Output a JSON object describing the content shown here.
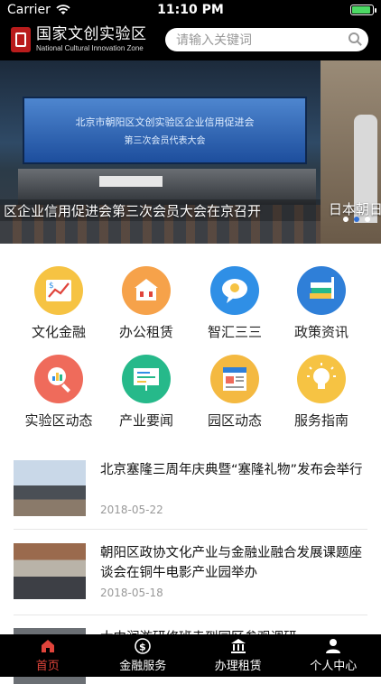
{
  "status_bar": {
    "carrier": "Carrier",
    "time": "11:10 PM",
    "battery_level": 0.95
  },
  "header": {
    "logo_cn": "国家文创实验区",
    "logo_en": "National Cultural Innovation Zone",
    "search_placeholder": "请输入关键词"
  },
  "banner": {
    "slides": [
      {
        "screen_title": "北京市朝阳区文创实验区企业信用促进会",
        "screen_subtitle": "第三次会员代表大会",
        "caption": "区企业信用促进会第三次会员大会在京召开"
      },
      {
        "caption": "日本朝日"
      }
    ],
    "active_index": 1,
    "dot_count": 3
  },
  "categories": [
    {
      "label": "文化金融",
      "icon": "finance-chart-icon",
      "color": "#f6c343"
    },
    {
      "label": "办公租赁",
      "icon": "office-building-icon",
      "color": "#f6a24a"
    },
    {
      "label": "智汇三三",
      "icon": "lightbulb-chat-icon",
      "color": "#2f8fe6"
    },
    {
      "label": "政策资讯",
      "icon": "books-icon",
      "color": "#2f7fd8"
    },
    {
      "label": "实验区动态",
      "icon": "magnifier-chart-icon",
      "color": "#ef6b5b"
    },
    {
      "label": "产业要闻",
      "icon": "presentation-board-icon",
      "color": "#26b98a"
    },
    {
      "label": "园区动态",
      "icon": "newspaper-icon",
      "color": "#f4b941"
    },
    {
      "label": "服务指南",
      "icon": "lightbulb-icon",
      "color": "#f6c343"
    }
  ],
  "news": [
    {
      "title": "北京塞隆三周年庆典暨“塞隆礼物”发布会举行",
      "date": "2018-05-22"
    },
    {
      "title": "朝阳区政协文化产业与金融业融合发展课题座谈会在铜牛电影产业园举办",
      "date": "2018-05-18"
    },
    {
      "title": "大中润游研修班走到园区参观调研",
      "date": ""
    }
  ],
  "tabbar": [
    {
      "label": "首页",
      "icon": "home-icon",
      "active": true
    },
    {
      "label": "金融服务",
      "icon": "dollar-circle-icon",
      "active": false
    },
    {
      "label": "办理租赁",
      "icon": "bank-building-icon",
      "active": false
    },
    {
      "label": "个人中心",
      "icon": "person-icon",
      "active": false
    }
  ],
  "colors": {
    "accent": "#e0443b",
    "active_dot": "#2f6fd6"
  }
}
